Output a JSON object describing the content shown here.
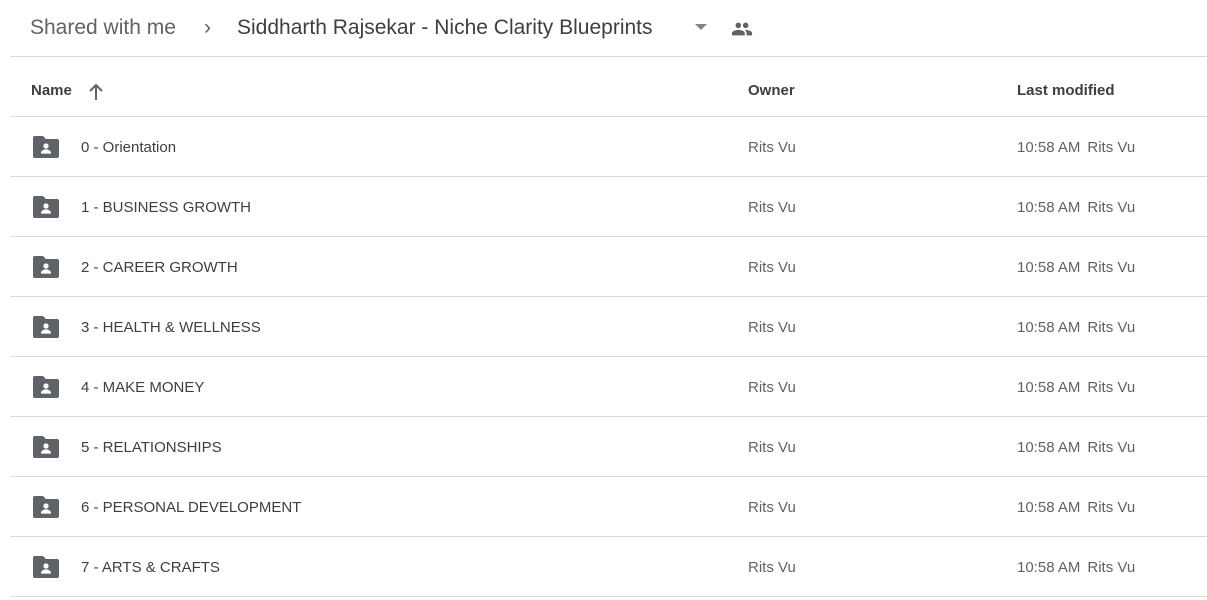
{
  "breadcrumb": {
    "root": "Shared with me",
    "separator": "›",
    "current": "Siddharth Rajsekar - Niche Clarity Blueprints"
  },
  "columns": {
    "name": "Name",
    "owner": "Owner",
    "last_modified": "Last modified"
  },
  "rows": [
    {
      "name": "0 - Orientation",
      "owner": "Rits Vu",
      "time": "10:58 AM",
      "by": "Rits Vu"
    },
    {
      "name": "1 - BUSINESS GROWTH",
      "owner": "Rits Vu",
      "time": "10:58 AM",
      "by": "Rits Vu"
    },
    {
      "name": "2 - CAREER GROWTH",
      "owner": "Rits Vu",
      "time": "10:58 AM",
      "by": "Rits Vu"
    },
    {
      "name": "3 - HEALTH & WELLNESS",
      "owner": "Rits Vu",
      "time": "10:58 AM",
      "by": "Rits Vu"
    },
    {
      "name": "4 - MAKE MONEY",
      "owner": "Rits Vu",
      "time": "10:58 AM",
      "by": "Rits Vu"
    },
    {
      "name": "5 - RELATIONSHIPS",
      "owner": "Rits Vu",
      "time": "10:58 AM",
      "by": "Rits Vu"
    },
    {
      "name": "6 - PERSONAL DEVELOPMENT",
      "owner": "Rits Vu",
      "time": "10:58 AM",
      "by": "Rits Vu"
    },
    {
      "name": "7 - ARTS & CRAFTS",
      "owner": "Rits Vu",
      "time": "10:58 AM",
      "by": "Rits Vu"
    }
  ]
}
